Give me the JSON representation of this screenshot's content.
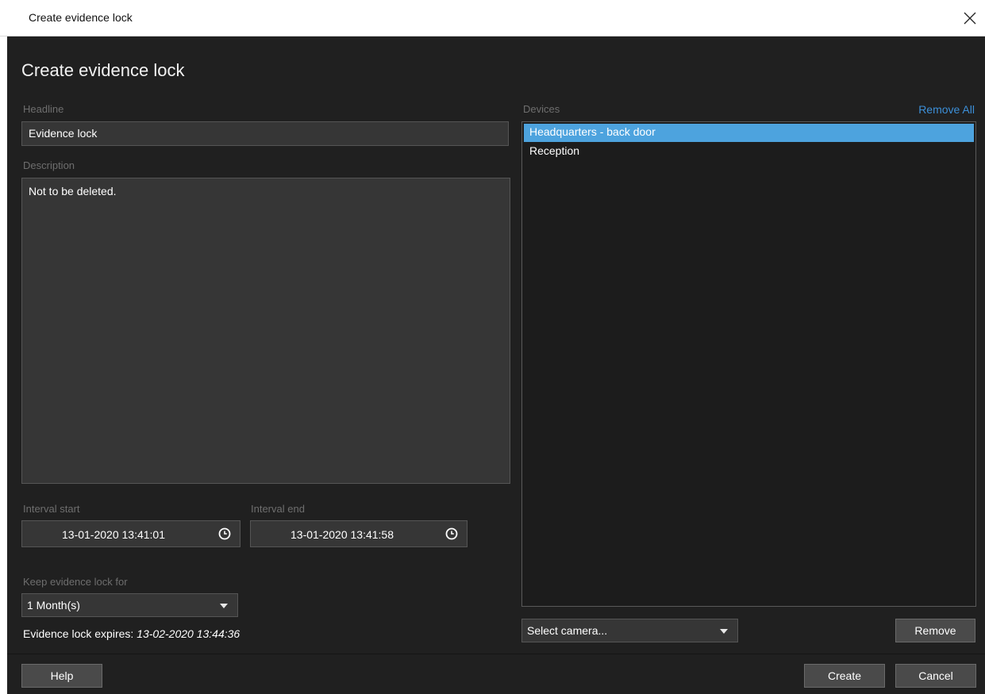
{
  "window": {
    "title": "Create evidence lock",
    "close_icon": "close-icon"
  },
  "dialog": {
    "heading": "Create evidence lock",
    "headline_label": "Headline",
    "headline_value": "Evidence lock",
    "description_label": "Description",
    "description_value": "Not to be deleted.",
    "interval_start_label": "Interval start",
    "interval_start_value": "13-01-2020 13:41:01",
    "interval_end_label": "Interval end",
    "interval_end_value": "13-01-2020 13:41:58",
    "keep_label": "Keep evidence lock for",
    "keep_value": "1 Month(s)",
    "expires_label": "Evidence lock expires:",
    "expires_value": "13-02-2020 13:44:36"
  },
  "devices": {
    "label": "Devices",
    "remove_all": "Remove All",
    "items": [
      {
        "label": "Headquarters - back door",
        "selected": true
      },
      {
        "label": "Reception",
        "selected": false
      }
    ],
    "select_camera": "Select camera...",
    "remove_label": "Remove"
  },
  "footer": {
    "help_label": "Help",
    "create_label": "Create",
    "cancel_label": "Cancel"
  },
  "colors": {
    "background": "#202020",
    "field": "#363636",
    "accent_link": "#3c8fd8",
    "selection": "#4da3de"
  }
}
